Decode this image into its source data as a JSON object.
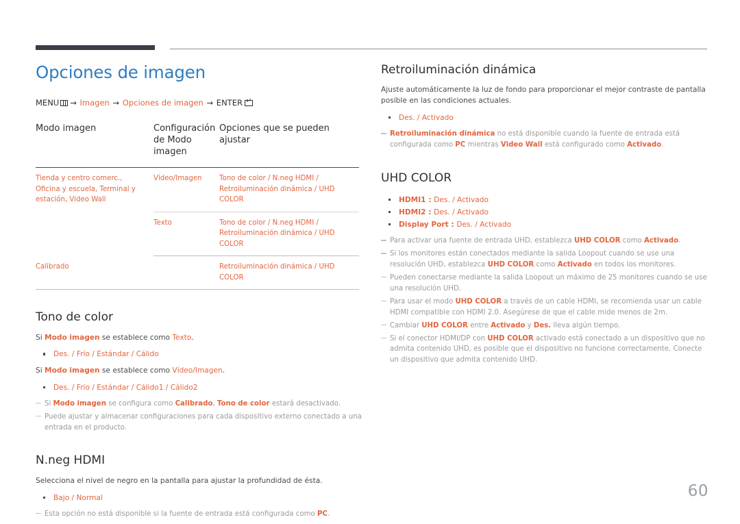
{
  "document": {
    "page_number": "60",
    "accent_blue": "#2e7dc0",
    "accent_orange": "#e2653f",
    "rule_dark": "#403a47"
  },
  "left": {
    "title": "Opciones de imagen",
    "breadcrumb": {
      "menu_label": "MENU",
      "menu_icon": "menu-icon",
      "arrow": "→",
      "item1": "Imagen",
      "item2": "Opciones de imagen",
      "enter_label": "ENTER",
      "enter_icon": "enter-key-icon"
    },
    "table": {
      "headers": [
        "Modo imagen",
        "Configuración de Modo imagen",
        "Opciones que se pueden ajustar"
      ],
      "rows": [
        {
          "mode": "Tienda y centro comerc., Oficina y escuela, Terminal y estación, Video Wall",
          "config": "Vídeo/Imagen",
          "options": "Tono de color / N.neg HDMI / Retroiluminación dinámica / UHD COLOR"
        },
        {
          "mode": "",
          "config": "Texto",
          "options": "Tono de color / N.neg HDMI / Retroiluminación dinámica / UHD COLOR"
        },
        {
          "mode": "Calibrado",
          "config": "",
          "options": "Retroiluminación dinámica / UHD COLOR"
        }
      ]
    },
    "tono_de_color": {
      "heading": "Tono de color",
      "line1_pre": "Si ",
      "line1_term": "Modo imagen",
      "line1_mid": " se establece como ",
      "line1_val": "Texto",
      "line1_end": ".",
      "options1": "Des. / Frío / Estándar / Cálido",
      "line2_pre": "Si ",
      "line2_term": "Modo imagen",
      "line2_mid": " se establece como ",
      "line2_val": "Vídeo/Imagen",
      "line2_end": ".",
      "options2": "Des. / Frío / Estándar / Cálido1 / Cálido2",
      "note1_a": "Si ",
      "note1_b": "Modo imagen",
      "note1_c": " se configura como ",
      "note1_d": "Calibrado",
      "note1_e": ", ",
      "note1_f": "Tono de color",
      "note1_g": " estará desactivado.",
      "note2": "Puede ajustar y almacenar configuraciones para cada dispositivo externo conectado a una entrada en el producto."
    },
    "nneg_hdmi": {
      "heading": "N.neg HDMI",
      "description": "Selecciona el nivel de negro en la pantalla para ajustar la profundidad de ésta.",
      "options": "Bajo / Normal",
      "note_a": "Esta opción no está disponible si la fuente de entrada está configurada como ",
      "note_b": "PC",
      "note_c": "."
    }
  },
  "right": {
    "retro": {
      "heading": "Retroiluminación dinámica",
      "description": "Ajuste automáticamente la luz de fondo para proporcionar el mejor contraste de pantalla posible en las condiciones actuales.",
      "options": "Des. / Activado",
      "note_a": "Retroiluminación dinámica",
      "note_b": " no está disponible cuando la fuente de entrada está configurada como ",
      "note_c": "PC",
      "note_d": " mientras ",
      "note_e": "Video Wall",
      "note_f": " está configurado como ",
      "note_g": "Activado",
      "note_h": "."
    },
    "uhd": {
      "heading": "UHD COLOR",
      "bullets": [
        {
          "lead": "HDMI1 : ",
          "rest": "Des. / Activado"
        },
        {
          "lead": "HDMI2 : ",
          "rest": "Des. / Activado"
        },
        {
          "lead": "Display Port : ",
          "rest": "Des. / Activado"
        }
      ],
      "notes": [
        {
          "parts": [
            {
              "t": "Para activar una fuente de entrada UHD, establezca ",
              "s": "g"
            },
            {
              "t": "UHD COLOR",
              "s": "ob"
            },
            {
              "t": " como ",
              "s": "g"
            },
            {
              "t": "Activado",
              "s": "ob"
            },
            {
              "t": ".",
              "s": "g"
            }
          ]
        },
        {
          "parts": [
            {
              "t": "Si los monitores están conectados mediante la salida Loopout cuando se use una resolución UHD, establezca ",
              "s": "g"
            },
            {
              "t": "UHD COLOR",
              "s": "ob"
            },
            {
              "t": " como ",
              "s": "g"
            },
            {
              "t": "Activado",
              "s": "ob"
            },
            {
              "t": " en todos los monitores.",
              "s": "g"
            }
          ]
        },
        {
          "parts": [
            {
              "t": "Pueden conectarse mediante la salida Loopout un máximo de 25 monitores cuando se use una resolución UHD.",
              "s": "g"
            }
          ]
        },
        {
          "parts": [
            {
              "t": "Para usar el modo ",
              "s": "g"
            },
            {
              "t": "UHD COLOR",
              "s": "ob"
            },
            {
              "t": " a través de un cable HDMI, se recomienda usar un cable HDMI compatible con HDMI 2.0. Asegúrese de que el cable mide menos de 2m.",
              "s": "g"
            }
          ]
        },
        {
          "parts": [
            {
              "t": "Cambiar ",
              "s": "g"
            },
            {
              "t": "UHD COLOR",
              "s": "ob"
            },
            {
              "t": " entre ",
              "s": "g"
            },
            {
              "t": "Activado",
              "s": "ob"
            },
            {
              "t": " y ",
              "s": "g"
            },
            {
              "t": "Des.",
              "s": "ob"
            },
            {
              "t": " lleva algún tiempo.",
              "s": "g"
            }
          ]
        },
        {
          "parts": [
            {
              "t": "Si el conector HDMI/DP con ",
              "s": "g"
            },
            {
              "t": "UHD COLOR",
              "s": "ob"
            },
            {
              "t": " activado está conectado a un dispositivo que no admita contenido UHD, es posible que el dispositivo no funcione correctamente. Conecte un dispositivo que admita contenido UHD.",
              "s": "g"
            }
          ]
        }
      ]
    }
  }
}
